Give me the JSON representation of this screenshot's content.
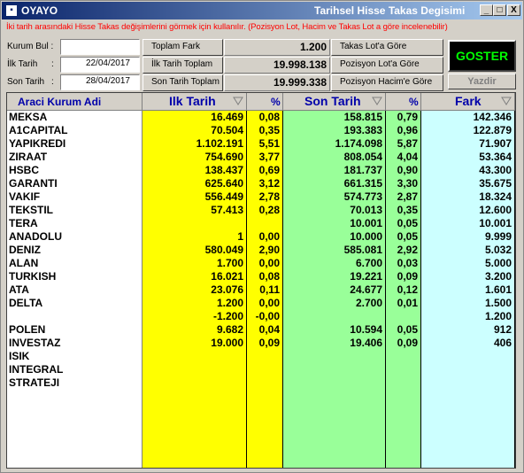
{
  "window": {
    "app_name": "OYAYO",
    "title": "Tarihsel Hisse Takas Degisimi",
    "minimize": "_",
    "maximize": "□",
    "close": "X"
  },
  "hint": "İki tarih arasındaki Hisse Takas değişimlerini görmek için kullanılır. (Pozisyon Lot, Hacim ve Takas Lot a göre incelenebilir)",
  "form": {
    "kurum_bul_label": "Kurum Bul :",
    "kurum_bul_value": "",
    "ilk_tarih_label": "İlk Tarih",
    "ilk_tarih_colon": ":",
    "ilk_tarih_value": "22/04/2017",
    "son_tarih_label": "Son Tarih",
    "son_tarih_colon": ":",
    "son_tarih_value": "28/04/2017"
  },
  "summary": {
    "toplam_fark_label": "Toplam Fark",
    "toplam_fark_value": "1.200",
    "ilk_tarih_toplam_label": "İlk Tarih Toplam",
    "ilk_tarih_toplam_value": "19.998.138",
    "son_tarih_toplam_label": "Son Tarih Toplam",
    "son_tarih_toplam_value": "19.999.338"
  },
  "options": {
    "takas_lot": "Takas Lot'a Göre",
    "pozisyon_lot": "Pozisyon Lot'a Göre",
    "pozisyon_hacim": "Pozisyon Hacim'e Göre"
  },
  "buttons": {
    "goster": "GOSTER",
    "yazdir": "Yazdir"
  },
  "colors": {
    "yellow_column": "#ffff00",
    "green_column": "#99ff99",
    "cyan_column": "#ccffff",
    "header_text": "#0000aa",
    "hint_text": "#ff0000",
    "goster_text": "#00ff00"
  },
  "table": {
    "headers": {
      "kurum": "Araci Kurum Adi",
      "ilk_tarih": "Ilk Tarih",
      "ilk_pct": "%",
      "son_tarih": "Son Tarih",
      "son_pct": "%",
      "fark": "Fark"
    },
    "kurum": [
      "MEKSA",
      "A1CAPITAL",
      "YAPIKREDI",
      "ZIRAAT",
      "HSBC",
      "GARANTI",
      "VAKIF",
      "TEKSTIL",
      "TERA",
      "ANADOLU",
      "DENIZ",
      "ALAN",
      "TURKISH",
      "ATA",
      "DELTA",
      "",
      "POLEN",
      "INVESTAZ",
      "ISIK",
      "INTEGRAL",
      "STRATEJI"
    ],
    "ilk_tarih": [
      "16.469",
      "70.504",
      "1.102.191",
      "754.690",
      "138.437",
      "625.640",
      "556.449",
      "57.413",
      "",
      "1",
      "580.049",
      "1.700",
      "16.021",
      "23.076",
      "1.200",
      "-1.200",
      "9.682",
      "19.000",
      "",
      "",
      ""
    ],
    "ilk_pct": [
      "0,08",
      "0,35",
      "5,51",
      "3,77",
      "0,69",
      "3,12",
      "2,78",
      "0,28",
      "",
      "0,00",
      "2,90",
      "0,00",
      "0,08",
      "0,11",
      "0,00",
      "-0,00",
      "0,04",
      "0,09",
      "",
      "",
      ""
    ],
    "son_tarih": [
      "158.815",
      "193.383",
      "1.174.098",
      "808.054",
      "181.737",
      "661.315",
      "574.773",
      "70.013",
      "10.001",
      "10.000",
      "585.081",
      "6.700",
      "19.221",
      "24.677",
      "2.700",
      "",
      "10.594",
      "19.406",
      "",
      "",
      ""
    ],
    "son_pct": [
      "0,79",
      "0,96",
      "5,87",
      "4,04",
      "0,90",
      "3,30",
      "2,87",
      "0,35",
      "0,05",
      "0,05",
      "2,92",
      "0,03",
      "0,09",
      "0,12",
      "0,01",
      "",
      "0,05",
      "0,09",
      "",
      "",
      ""
    ],
    "fark": [
      "142.346",
      "122.879",
      "71.907",
      "53.364",
      "43.300",
      "35.675",
      "18.324",
      "12.600",
      "10.001",
      "9.999",
      "5.032",
      "5.000",
      "3.200",
      "1.601",
      "1.500",
      "1.200",
      "912",
      "406",
      "",
      "",
      ""
    ]
  }
}
